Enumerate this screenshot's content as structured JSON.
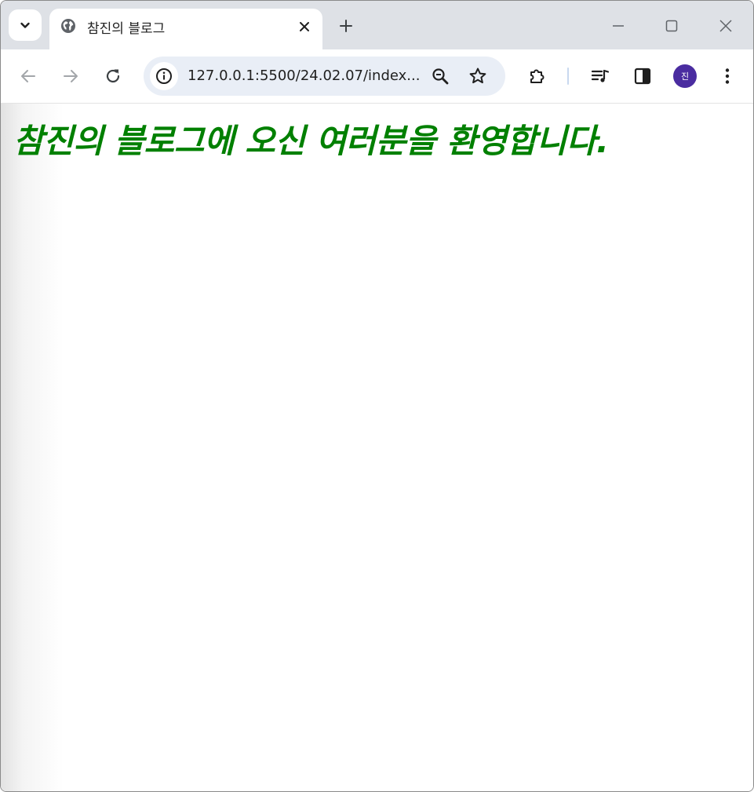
{
  "browser": {
    "tab": {
      "title": "참진의 블로그",
      "favicon": "globe-icon"
    },
    "address_bar": {
      "url": "127.0.0.1:5500/24.02.07/index..."
    },
    "profile": {
      "initial": "진",
      "color": "#4a2ca0"
    }
  },
  "page": {
    "heading": "참진의 블로그에 오신 여러분을 환영합니다.",
    "heading_color": "#008000"
  }
}
